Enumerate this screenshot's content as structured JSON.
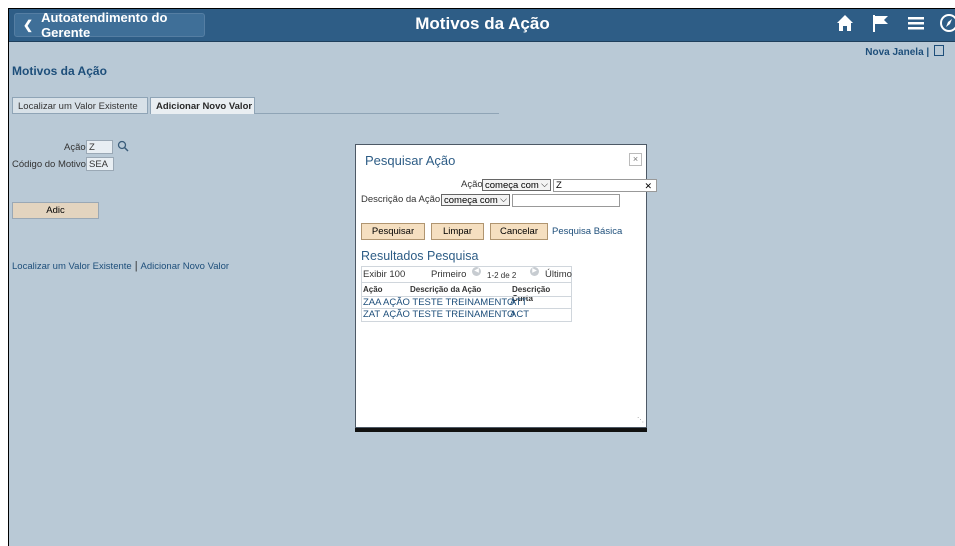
{
  "header": {
    "back_label": "Autoatendimento do Gerente",
    "title": "Motivos da Ação"
  },
  "nova_janela": "Nova Janela",
  "page_title": "Motivos da Ação",
  "tabs": [
    {
      "label": "Localizar um Valor Existente"
    },
    {
      "label": "Adicionar Novo Valor"
    }
  ],
  "form": {
    "acao_label": "Ação",
    "acao_value": "Z",
    "motivo_label": "Código do Motivo",
    "motivo_value": "SEA",
    "adic_label": "Adic"
  },
  "bottom_links": {
    "find": "Localizar um Valor Existente",
    "add": "Adicionar Novo Valor"
  },
  "modal": {
    "title": "Pesquisar Ação",
    "close": "×",
    "acao_label": "Ação",
    "acao_operator": "começa com",
    "acao_value": "Z",
    "desc_label": "Descrição da Ação",
    "desc_operator": "começa com",
    "desc_value": "",
    "buttons": {
      "search": "Pesquisar",
      "clear": "Limpar",
      "cancel": "Cancelar"
    },
    "basic_search": "Pesquisa Básica",
    "results_title": "Resultados Pesquisa",
    "nav": {
      "show": "Exibir 100",
      "first": "Primeiro",
      "range": "1-2 de 2",
      "last": "Último"
    },
    "columns": [
      "Ação",
      "Descrição da Ação",
      "Descrição Curta"
    ],
    "rows": [
      {
        "code": "ZAA",
        "desc": "AÇÃO TESTE TREINAMENTO",
        "short": "ATT"
      },
      {
        "code": "ZAT",
        "desc": "AÇÃO TESTE TREINAMENTO",
        "short": "ACT"
      }
    ]
  },
  "colors": {
    "header_bg": "#2e5d86",
    "page_bg": "#b9c9d6",
    "link": "#1d4e7a",
    "button_bg": "#f5dfc0"
  }
}
